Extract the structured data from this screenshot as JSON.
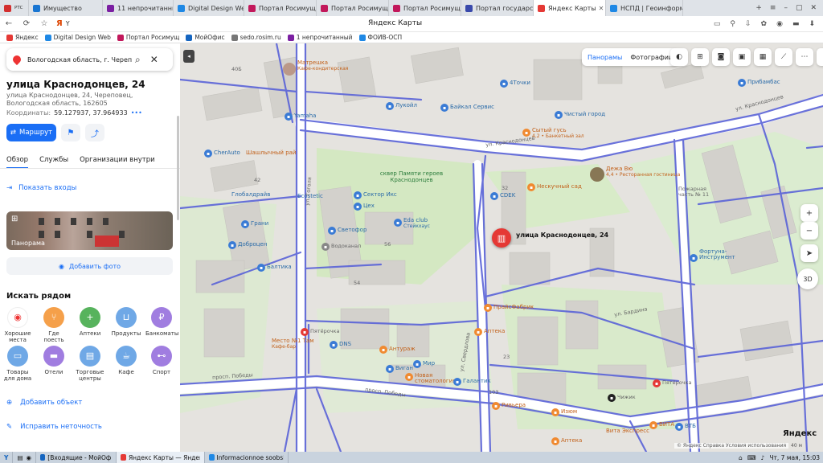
{
  "browser": {
    "tabs": [
      {
        "label": "РТС",
        "color": "#d32f2f"
      },
      {
        "label": "Имущество",
        "color": "#1976d2"
      },
      {
        "label": "11 непрочитанных",
        "color": "#7b1fa2"
      },
      {
        "label": "Digital Design Web",
        "color": "#1e88e5"
      },
      {
        "label": "Портал Росимущест",
        "color": "#c2185b"
      },
      {
        "label": "Портал Росимущест",
        "color": "#c2185b"
      },
      {
        "label": "Портал Росимущест",
        "color": "#c2185b"
      },
      {
        "label": "Портал государстве",
        "color": "#3949ab"
      },
      {
        "label": "Яндекс Карты",
        "color": "#e53935"
      },
      {
        "label": "НСПД | Геоинформ",
        "color": "#1e88e5"
      }
    ],
    "page_title": "Яндекс Карты",
    "bookmarks": [
      {
        "label": "Яндекс",
        "color": "#e53935"
      },
      {
        "label": "Digital Design Web",
        "color": "#1e88e5"
      },
      {
        "label": "Портал Росимущ",
        "color": "#c2185b"
      },
      {
        "label": "МойОфис",
        "color": "#1565c0"
      },
      {
        "label": "sedo.rosim.ru",
        "color": "#777777"
      },
      {
        "label": "1 непрочитанный",
        "color": "#7b1fa2"
      },
      {
        "label": "ФОИВ-ОСП",
        "color": "#1e88e5"
      }
    ]
  },
  "search": {
    "value": "Вологодская область, г. Череповец,"
  },
  "place": {
    "title": "улица Краснодонцев, 24",
    "address": "улица Краснодонцев, 24, Череповец, Вологодская область, 162605",
    "coords_label": "Координаты:",
    "coords_value": "59.127937, 37.964933"
  },
  "actions": {
    "route": "Маршрут"
  },
  "tabs": [
    "Обзор",
    "Службы",
    "Организации внутри"
  ],
  "show_entrances": "Показать входы",
  "photo_label": "Панорама",
  "add_photo": "Добавить фото",
  "nearby": {
    "title": "Искать рядом",
    "row1": [
      {
        "label": "Хорошие места",
        "color": "#ffffff",
        "glyph": "◉"
      },
      {
        "label": "Где поесть",
        "color": "#f5a04a",
        "glyph": "⑂"
      },
      {
        "label": "Аптеки",
        "color": "#57b35d",
        "glyph": "+"
      },
      {
        "label": "Продукты",
        "color": "#6fa8e6",
        "glyph": "⊔"
      },
      {
        "label": "Банкоматы",
        "color": "#a07de0",
        "glyph": "₽"
      }
    ],
    "row2": [
      {
        "label": "Товары для дома",
        "color": "#6fa8e6",
        "glyph": "▭"
      },
      {
        "label": "Отели",
        "color": "#a07de0",
        "glyph": "▬"
      },
      {
        "label": "Торговые центры",
        "color": "#6fa8e6",
        "glyph": "▤"
      },
      {
        "label": "Кафе",
        "color": "#6fa8e6",
        "glyph": "☕"
      },
      {
        "label": "Спорт",
        "color": "#a07de0",
        "glyph": "⊷"
      }
    ]
  },
  "add_object": "Добавить объект",
  "fix_error": "Исправить неточность",
  "map": {
    "layers": [
      "Панорамы",
      "Фотографии"
    ],
    "pin_label": "улица Краснодонцев, 24",
    "logo": "Яндекс",
    "copyright": "© Яндекс  Справка  Условия использования",
    "scale": "40 м",
    "labels": {
      "matreshka": "Матрешка",
      "matreshka_sub": "Кафе-кондитерская",
      "chetochki": "4Точки",
      "lukoil": "Лукойл",
      "baikal": "Байкал Сервис",
      "pribambas": "Прибамбас",
      "chisty": "Чистый город",
      "yamaha": "Yamaha",
      "sytiy": "Сытый гусь",
      "sytiy_sub": "4,2 • Банкетный зал",
      "cherauto": "CherAuto",
      "shashlyk": "Шашлычный рай",
      "square": "сквер Памяти героев Краснодонцев",
      "deja": "Дежа Вю",
      "deja_sub": "4,4 • Ресторанная гостиница",
      "neskuchny": "Нескучный сад",
      "pozharnaya": "Пожарная часть № 11",
      "globaldrive": "Глобалдрайв",
      "ecostetic": "Ecostetic",
      "sektor": "Сектор Икс",
      "cdek": "CDEK",
      "tseh": "Цех",
      "grani": "Грани",
      "edaclub": "Eda club",
      "edaclub_sub": "Стейкхаус",
      "svetofor": "Светофор",
      "dobrocen": "Доброцен",
      "vodokanal": "Водоканал",
      "fortuna": "Фортуна-Инструмент",
      "baltika": "Балтика",
      "pricefabrik": "ПрайсФабрик",
      "pyaterochka1": "Пятёрочка",
      "apte": "Аптека",
      "mesto": "Место №1 Там",
      "mesto_sub": "Кафе-бар",
      "dns": "DNS",
      "antrazh": "Антураж",
      "vigan": "Виган",
      "mir": "Мир",
      "novaya": "Новая стоматология",
      "galantik": "Галантик",
      "riviera": "Ривьера",
      "izyum": "Изюм",
      "chizhik": "Чижик",
      "pyaterochka2": "Пятёрочка",
      "vita": "ВИТА",
      "vita_express": "Вита Экспресс",
      "vtb": "ВТБ",
      "apteka2": "Аптека",
      "st_krasnodontsev": "ул. Краснодонцев",
      "st_krasnodontsev2": "ул. Краснодонцев",
      "st_sverdlova": "ул. Свердлова",
      "st_gogolya": "ул. Гоголя",
      "st_pobedy": "просп. Победы",
      "st_pobedy2": "просп. Победы",
      "st_bardina": "ул. Бардина",
      "n40": "40Б",
      "n32": "32",
      "n42": "42",
      "n56": "56",
      "n54": "54",
      "n23": "23",
      "n103": "103"
    }
  },
  "taskbar": {
    "items": [
      {
        "label": "[Входящие - МойОфис П...",
        "color": "#1565c0"
      },
      {
        "label": "Яндекс Карты — Яндекс...",
        "color": "#e53935"
      },
      {
        "label": "Informacionnoe soobshhe...",
        "color": "#1e88e5"
      }
    ],
    "clock": "Чт, 7 мая, 15:03"
  }
}
